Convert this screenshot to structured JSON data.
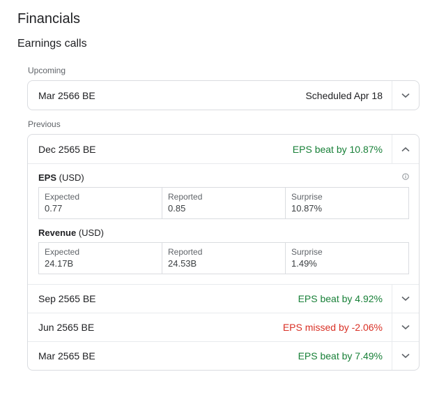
{
  "header": {
    "title": "Financials",
    "subtitle": "Earnings calls"
  },
  "colors": {
    "positive": "#188038",
    "negative": "#d93025",
    "neutral": "#202124"
  },
  "upcoming": {
    "label": "Upcoming",
    "items": [
      {
        "date": "Mar 2566 BE",
        "status": "Scheduled Apr 18",
        "tone": "neutral",
        "expanded": false,
        "toggle_icon": "chevron-down-icon"
      }
    ]
  },
  "previous": {
    "label": "Previous",
    "items": [
      {
        "date": "Dec 2565 BE",
        "status": "EPS beat by 10.87%",
        "tone": "positive",
        "expanded": true,
        "toggle_icon": "chevron-up-icon",
        "details": {
          "eps": {
            "title": "EPS",
            "unit": "(USD)",
            "info_icon": "info-icon",
            "expected_label": "Expected",
            "expected": "0.77",
            "reported_label": "Reported",
            "reported": "0.85",
            "surprise_label": "Surprise",
            "surprise": "10.87%"
          },
          "revenue": {
            "title": "Revenue",
            "unit": "(USD)",
            "expected_label": "Expected",
            "expected": "24.17B",
            "reported_label": "Reported",
            "reported": "24.53B",
            "surprise_label": "Surprise",
            "surprise": "1.49%"
          }
        }
      },
      {
        "date": "Sep 2565 BE",
        "status": "EPS beat by 4.92%",
        "tone": "positive",
        "expanded": false,
        "toggle_icon": "chevron-down-icon"
      },
      {
        "date": "Jun 2565 BE",
        "status": "EPS missed by -2.06%",
        "tone": "negative",
        "expanded": false,
        "toggle_icon": "chevron-down-icon"
      },
      {
        "date": "Mar 2565 BE",
        "status": "EPS beat by 7.49%",
        "tone": "positive",
        "expanded": false,
        "toggle_icon": "chevron-down-icon"
      }
    ]
  }
}
